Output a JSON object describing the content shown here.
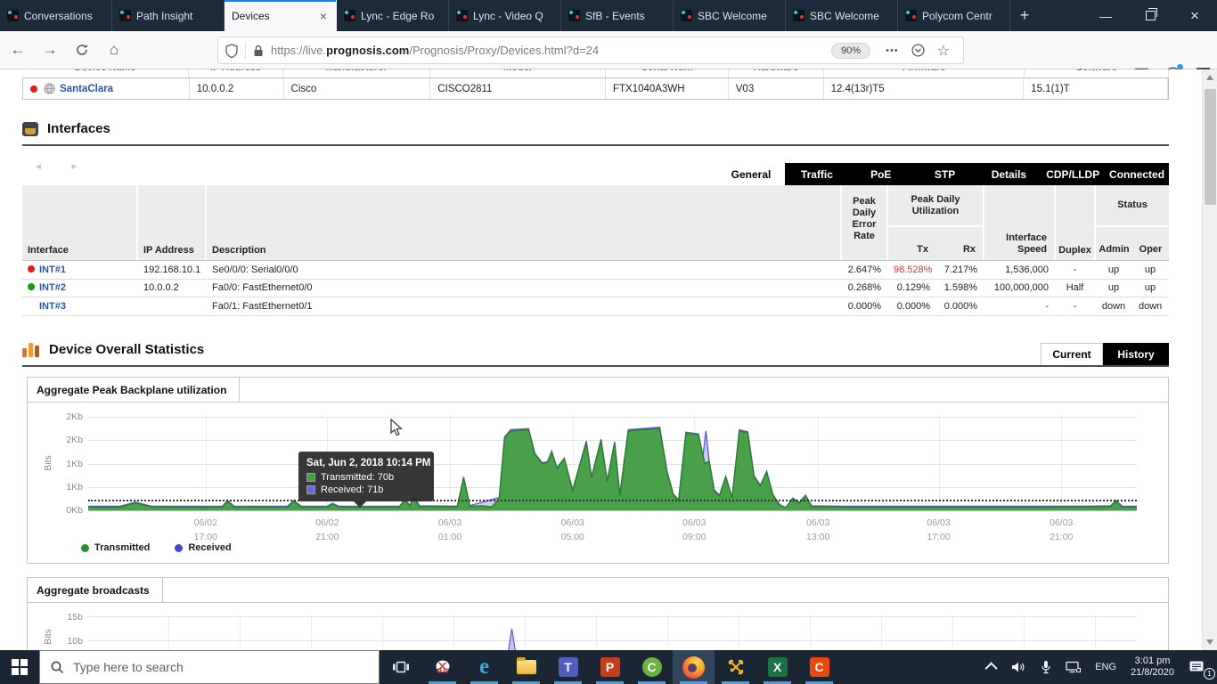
{
  "browser": {
    "tabs": [
      {
        "label": "Conversations",
        "active": false
      },
      {
        "label": "Path Insight",
        "active": false
      },
      {
        "label": "Devices",
        "active": true
      },
      {
        "label": "Lync - Edge Ro",
        "active": false
      },
      {
        "label": "Lync - Video Q",
        "active": false
      },
      {
        "label": "SfB - Events",
        "active": false
      },
      {
        "label": "SBC Welcome",
        "active": false
      },
      {
        "label": "SBC Welcome",
        "active": false
      },
      {
        "label": "Polycom Centr",
        "active": false
      }
    ],
    "new_tab_label": "+",
    "url": {
      "prefix": "https://live.",
      "domain": "prognosis.com",
      "path": "/Prognosis/Proxy/Devices.html?d=24"
    },
    "zoom_badge": "90%",
    "dots": "•••",
    "star": "☆",
    "back": "←",
    "forward": "→",
    "home": "⌂"
  },
  "device_table": {
    "headers": [
      "Device Name",
      "IP Address",
      "Manufacturer",
      "Model",
      "Serial Num",
      "Hardware",
      "Firmware",
      "Software"
    ],
    "row": {
      "name": "SantaClara",
      "ip": "10.0.0.2",
      "manufacturer": "Cisco",
      "model": "CISCO2811",
      "serial": "FTX1040A3WH",
      "hardware": "V03",
      "firmware": "12.4(13r)T5",
      "software": "15.1(1)T",
      "status": "red"
    }
  },
  "interfaces": {
    "title": "Interfaces",
    "pager": "◄ ►",
    "tabs": [
      {
        "label": "General",
        "active": true
      },
      {
        "label": "Traffic",
        "active": false
      },
      {
        "label": "PoE",
        "active": false
      },
      {
        "label": "STP",
        "active": false
      },
      {
        "label": "Details",
        "active": false
      },
      {
        "label": "CDP/LLDP",
        "active": false
      },
      {
        "label": "Connected",
        "active": false
      }
    ],
    "table": {
      "col_headers": {
        "interface": "Interface",
        "ip": "IP Address",
        "description": "Description",
        "error": "Peak Daily Error Rate",
        "util_group": "Peak Daily Utilization",
        "tx": "Tx",
        "rx": "Rx",
        "speed": "Interface Speed",
        "duplex": "Duplex",
        "status_group": "Status",
        "admin": "Admin",
        "oper": "Oper"
      },
      "rows": [
        {
          "status": "red",
          "interface": "INT#1",
          "ip": "192.168.10.1",
          "description": "Se0/0/0: Serial0/0/0",
          "error": "2.647%",
          "tx": "98.528%",
          "tx_alert": true,
          "rx": "7.217%",
          "speed": "1,536,000",
          "duplex": "-",
          "admin": "up",
          "oper": "up"
        },
        {
          "status": "green",
          "interface": "INT#2",
          "ip": "10.0.0.2",
          "description": "Fa0/0: FastEthernet0/0",
          "error": "0.268%",
          "tx": "0.129%",
          "tx_alert": false,
          "rx": "1.598%",
          "speed": "100,000,000",
          "duplex": "Half",
          "admin": "up",
          "oper": "up"
        },
        {
          "status": "none",
          "interface": "INT#3",
          "ip": "",
          "description": "Fa0/1: FastEthernet0/1",
          "error": "0.000%",
          "tx": "0.000%",
          "tx_alert": false,
          "rx": "0.000%",
          "speed": "-",
          "duplex": "-",
          "admin": "down",
          "oper": "down"
        }
      ]
    }
  },
  "device_stats": {
    "title": "Device Overall Statistics",
    "tabs": {
      "current": "Current",
      "history": "History"
    }
  },
  "chart_data": [
    {
      "type": "area",
      "title": "Aggregate Peak Backplane utilization",
      "ylabel": "Bits",
      "ylim": [
        0,
        2000
      ],
      "ytick_labels": [
        "2Kb",
        "2Kb",
        "1Kb",
        "1Kb",
        "0Kb"
      ],
      "ytick_values": [
        2000,
        1500,
        1000,
        500,
        0
      ],
      "xtick_fractions": [
        0.112,
        0.228,
        0.345,
        0.462,
        0.578,
        0.696,
        0.811,
        0.928
      ],
      "xtick_labels": [
        [
          "06/02",
          "17:00"
        ],
        [
          "06/02",
          "21:00"
        ],
        [
          "06/03",
          "01:00"
        ],
        [
          "06/03",
          "05:00"
        ],
        [
          "06/03",
          "09:00"
        ],
        [
          "06/03",
          "13:00"
        ],
        [
          "06/03",
          "17:00"
        ],
        [
          "06/03",
          "21:00"
        ]
      ],
      "threshold_bits": 230,
      "grid": true,
      "legend_position": "bottom-left",
      "legend": [
        {
          "name": "Transmitted",
          "color": "#2e8b2e"
        },
        {
          "name": "Received",
          "color": "#4646c8"
        }
      ],
      "series": [
        {
          "name": "Received",
          "stroke": "#5b5bd6",
          "fill": "rgba(91,91,214,0.30)",
          "points": [
            [
              0,
              85
            ],
            [
              0.03,
              85
            ],
            [
              0.045,
              175
            ],
            [
              0.06,
              90
            ],
            [
              0.1,
              85
            ],
            [
              0.128,
              90
            ],
            [
              0.133,
              210
            ],
            [
              0.139,
              90
            ],
            [
              0.19,
              85
            ],
            [
              0.196,
              210
            ],
            [
              0.203,
              90
            ],
            [
              0.228,
              85
            ],
            [
              0.233,
              150
            ],
            [
              0.239,
              85
            ],
            [
              0.297,
              90
            ],
            [
              0.302,
              230
            ],
            [
              0.307,
              105
            ],
            [
              0.31,
              315
            ],
            [
              0.316,
              95
            ],
            [
              0.352,
              90
            ],
            [
              0.358,
              715
            ],
            [
              0.364,
              100
            ],
            [
              0.392,
              275
            ],
            [
              0.397,
              1565
            ],
            [
              0.403,
              1725
            ],
            [
              0.42,
              1745
            ],
            [
              0.426,
              1215
            ],
            [
              0.433,
              1015
            ],
            [
              0.438,
              1040
            ],
            [
              0.442,
              1265
            ],
            [
              0.447,
              915
            ],
            [
              0.454,
              1115
            ],
            [
              0.462,
              435
            ],
            [
              0.468,
              915
            ],
            [
              0.475,
              1480
            ],
            [
              0.48,
              715
            ],
            [
              0.489,
              1520
            ],
            [
              0.495,
              635
            ],
            [
              0.502,
              1465
            ],
            [
              0.507,
              335
            ],
            [
              0.515,
              1725
            ],
            [
              0.545,
              1775
            ],
            [
              0.552,
              835
            ],
            [
              0.558,
              345
            ],
            [
              0.563,
              225
            ],
            [
              0.57,
              1670
            ],
            [
              0.582,
              1635
            ],
            [
              0.586,
              1100
            ],
            [
              0.589,
              1700
            ],
            [
              0.592,
              1080
            ],
            [
              0.597,
              435
            ],
            [
              0.602,
              325
            ],
            [
              0.608,
              725
            ],
            [
              0.614,
              275
            ],
            [
              0.621,
              1720
            ],
            [
              0.629,
              1680
            ],
            [
              0.635,
              735
            ],
            [
              0.641,
              535
            ],
            [
              0.647,
              835
            ],
            [
              0.653,
              335
            ],
            [
              0.659,
              135
            ],
            [
              0.665,
              40
            ],
            [
              0.672,
              265
            ],
            [
              0.678,
              165
            ],
            [
              0.684,
              325
            ],
            [
              0.69,
              95
            ],
            [
              0.72,
              85
            ],
            [
              0.8,
              85
            ],
            [
              0.9,
              85
            ],
            [
              0.955,
              90
            ],
            [
              0.975,
              95
            ],
            [
              0.98,
              212
            ],
            [
              0.986,
              87
            ],
            [
              1,
              85
            ]
          ]
        },
        {
          "name": "Transmitted",
          "stroke": "#2a7f2a",
          "fill": "#4aa04a",
          "points": [
            [
              0,
              70
            ],
            [
              0.03,
              70
            ],
            [
              0.045,
              160
            ],
            [
              0.06,
              75
            ],
            [
              0.1,
              70
            ],
            [
              0.128,
              75
            ],
            [
              0.133,
              195
            ],
            [
              0.139,
              75
            ],
            [
              0.19,
              70
            ],
            [
              0.196,
              195
            ],
            [
              0.203,
              75
            ],
            [
              0.228,
              70
            ],
            [
              0.233,
              135
            ],
            [
              0.239,
              70
            ],
            [
              0.297,
              75
            ],
            [
              0.302,
              215
            ],
            [
              0.307,
              90
            ],
            [
              0.31,
              300
            ],
            [
              0.316,
              80
            ],
            [
              0.352,
              75
            ],
            [
              0.358,
              700
            ],
            [
              0.364,
              85
            ],
            [
              0.375,
              95
            ],
            [
              0.385,
              75
            ],
            [
              0.392,
              260
            ],
            [
              0.397,
              1550
            ],
            [
              0.403,
              1700
            ],
            [
              0.42,
              1720
            ],
            [
              0.426,
              1200
            ],
            [
              0.433,
              1000
            ],
            [
              0.438,
              1020
            ],
            [
              0.442,
              1250
            ],
            [
              0.447,
              900
            ],
            [
              0.454,
              1100
            ],
            [
              0.462,
              420
            ],
            [
              0.468,
              900
            ],
            [
              0.475,
              1460
            ],
            [
              0.48,
              700
            ],
            [
              0.489,
              1500
            ],
            [
              0.495,
              620
            ],
            [
              0.502,
              1450
            ],
            [
              0.507,
              320
            ],
            [
              0.515,
              1700
            ],
            [
              0.545,
              1750
            ],
            [
              0.552,
              820
            ],
            [
              0.558,
              330
            ],
            [
              0.563,
              210
            ],
            [
              0.57,
              1650
            ],
            [
              0.582,
              1620
            ],
            [
              0.588,
              1000
            ],
            [
              0.592,
              1050
            ],
            [
              0.597,
              420
            ],
            [
              0.602,
              310
            ],
            [
              0.608,
              710
            ],
            [
              0.614,
              260
            ],
            [
              0.621,
              1700
            ],
            [
              0.629,
              1660
            ],
            [
              0.635,
              720
            ],
            [
              0.641,
              520
            ],
            [
              0.647,
              820
            ],
            [
              0.653,
              320
            ],
            [
              0.659,
              120
            ],
            [
              0.665,
              60
            ],
            [
              0.672,
              250
            ],
            [
              0.678,
              150
            ],
            [
              0.684,
              310
            ],
            [
              0.69,
              80
            ],
            [
              0.72,
              70
            ],
            [
              0.8,
              70
            ],
            [
              0.9,
              70
            ],
            [
              0.955,
              75
            ],
            [
              0.975,
              80
            ],
            [
              0.98,
              200
            ],
            [
              0.986,
              72
            ],
            [
              1,
              70
            ]
          ]
        }
      ],
      "tooltip": {
        "title": "Sat, Jun 2, 2018 10:14 PM",
        "rows": [
          {
            "label": "Transmitted: 70b",
            "color": "#3fa33f"
          },
          {
            "label": "Received: 71b",
            "color": "#6b6bd8"
          }
        ]
      }
    },
    {
      "type": "area",
      "title": "Aggregate broadcasts",
      "ylabel": "Bits",
      "ylim": [
        0,
        15
      ],
      "ytick_labels": [
        "15b",
        "10b"
      ],
      "ytick_values": [
        15,
        10
      ],
      "note": "chart mostly hidden behind taskbar",
      "series": [
        {
          "name": "Received",
          "stroke": "#5b5bd6",
          "fill": "rgba(91,91,214,0.35)",
          "points": [
            [
              0,
              0
            ],
            [
              0.395,
              0
            ],
            [
              0.404,
              12.4
            ],
            [
              0.413,
              0
            ],
            [
              1,
              0
            ]
          ]
        }
      ]
    }
  ],
  "taskbar": {
    "search_placeholder": "Type here to search",
    "apps": [
      "task-view",
      "snipping-tool",
      "edge",
      "file-explorer",
      "teams",
      "powerpoint",
      "camtasia",
      "firefox",
      "network-tool",
      "excel",
      "camtasia-recorder"
    ],
    "tray": {
      "lang": "ENG",
      "time": "3:01 pm",
      "date": "21/8/2020",
      "notification_count": "1"
    }
  }
}
